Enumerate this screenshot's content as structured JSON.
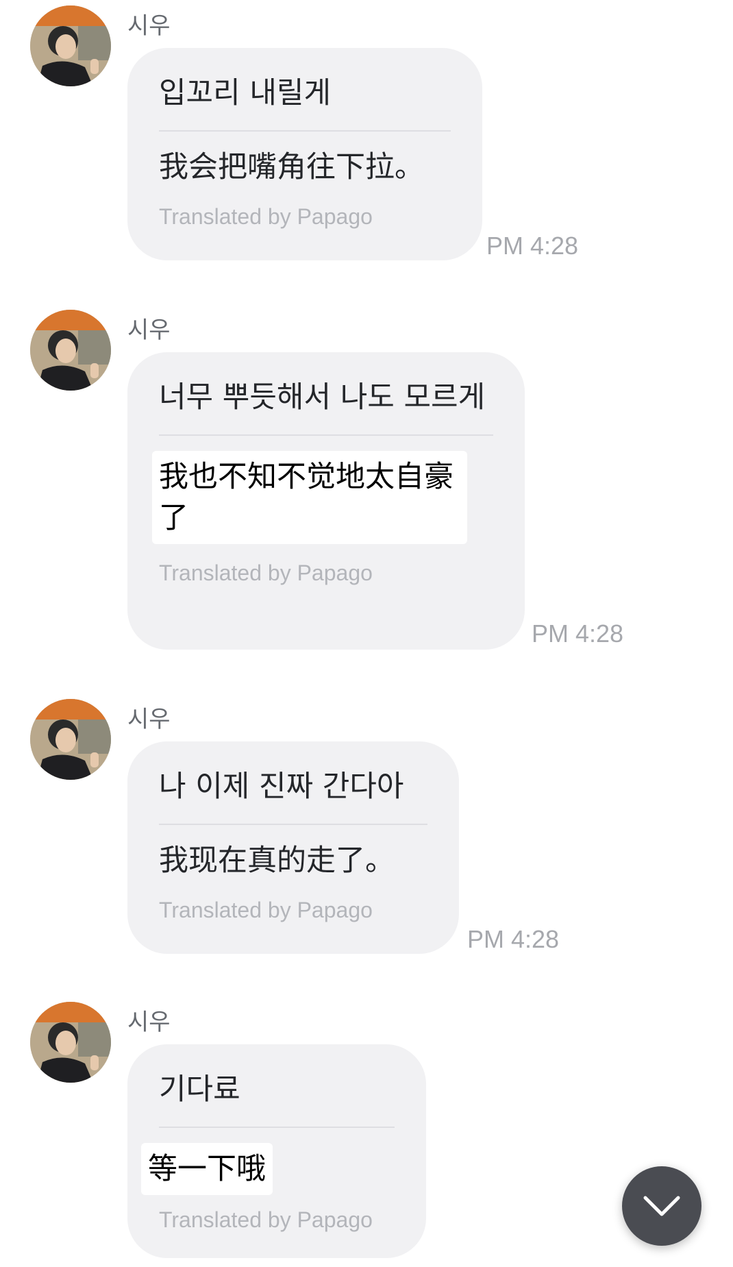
{
  "messages": [
    {
      "sender": "시우",
      "original": "입꼬리 내릴게",
      "translated": "我会把嘴角往下拉。",
      "translated_by": "Translated by Papago",
      "time": "PM 4:28"
    },
    {
      "sender": "시우",
      "original": "너무 뿌듯해서 나도 모르게",
      "translated": "我也不知不觉地太自豪了",
      "translated_by": "Translated by Papago",
      "time": "PM 4:28"
    },
    {
      "sender": "시우",
      "original": "나 이제 진짜 간다아",
      "translated": "我现在真的走了。",
      "translated_by": "Translated by Papago",
      "time": "PM 4:28"
    },
    {
      "sender": "시우",
      "original": "기다료",
      "translated": "等一下哦",
      "translated_by": "Translated by Papago",
      "time": ""
    }
  ],
  "scroll_button": {
    "icon": "chevron-down-icon"
  },
  "colors": {
    "bubble": "#f1f1f3",
    "time": "#a6a8ad",
    "scroll_button": "#4a4c52"
  }
}
